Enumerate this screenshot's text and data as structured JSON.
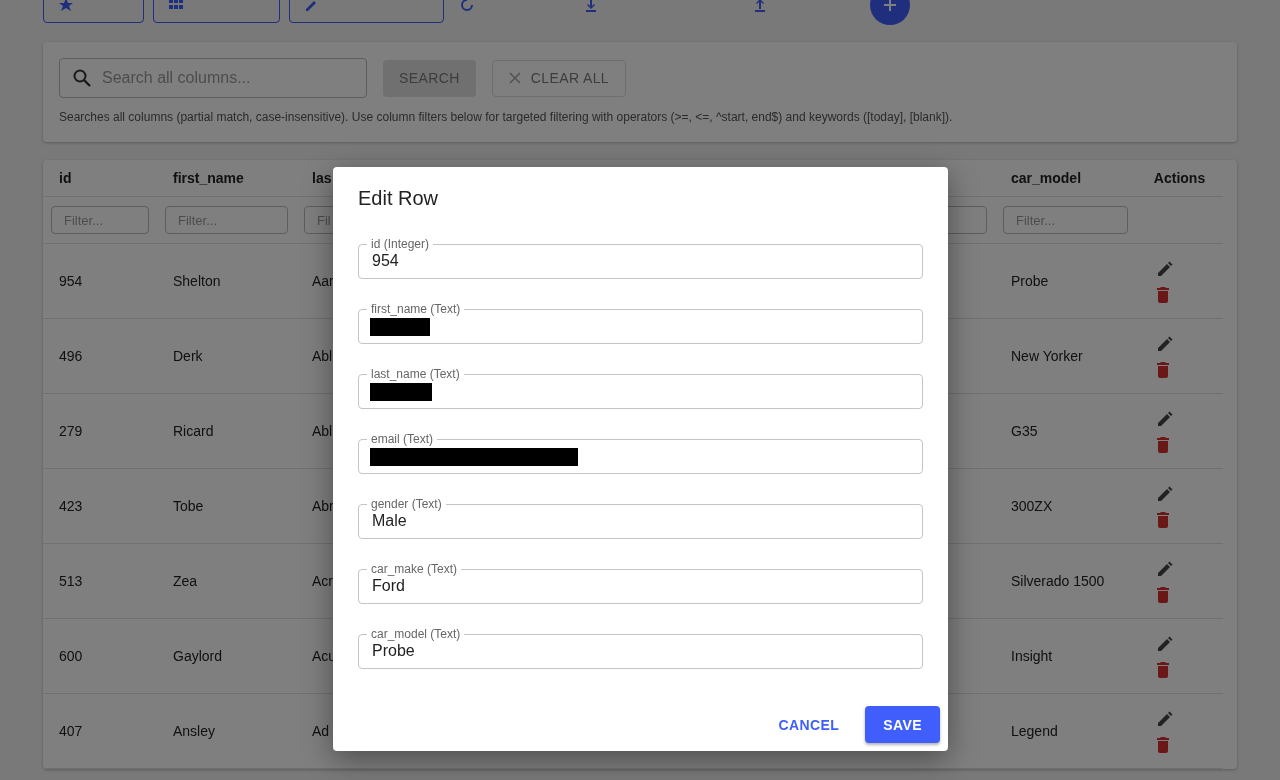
{
  "toolbar": {
    "buttons": [
      {
        "kind": "outlined"
      },
      {
        "kind": "outlined"
      },
      {
        "kind": "outlined"
      },
      {
        "kind": "text"
      },
      {
        "kind": "text"
      },
      {
        "kind": "text"
      },
      {
        "kind": "fab"
      }
    ]
  },
  "search": {
    "placeholder": "Search all columns...",
    "buttons": [
      {
        "label": "SEARCH",
        "kind": "contained",
        "disabled": true
      },
      {
        "label": "CLEAR ALL",
        "kind": "outlined",
        "disabled": true
      }
    ],
    "hint": "Searches all columns (partial match, case-insensitive). Use column filters below for targeted filtering with operators (>=, <=, ^start, end$) and keywords ([today], [blank])."
  },
  "table": {
    "columns": [
      {
        "header": "id",
        "placeholder": "Filter..."
      },
      {
        "header": "first_name",
        "placeholder": "Filter..."
      },
      {
        "header": "las",
        "placeholder": "Fil"
      },
      {},
      {
        "header": "car_model",
        "placeholder": "Filter..."
      },
      {
        "header": "Actions"
      }
    ],
    "rows": [
      {
        "id": "954",
        "first_name": "Shelton",
        "column_3": "Aar",
        "car_model": "Probe"
      },
      {
        "id": "496",
        "first_name": "Derk",
        "column_3": "Abl",
        "car_model": "New Yorker"
      },
      {
        "id": "279",
        "first_name": "Ricard",
        "column_3": "Abl",
        "car_model": "G35"
      },
      {
        "id": "423",
        "first_name": "Tobe",
        "column_3": "Abr",
        "car_model": "300ZX"
      },
      {
        "id": "513",
        "first_name": "Zea",
        "column_3": "Acr",
        "car_model": "Silverado 1500"
      },
      {
        "id": "600",
        "first_name": "Gaylord",
        "column_3": "Acu",
        "car_model": "Insight"
      },
      {
        "id": "407",
        "first_name": "Ansley",
        "column_3": "Ad",
        "car_model": "Legend"
      }
    ]
  },
  "dialog": {
    "title": "Edit Row",
    "fields": [
      {
        "label": "id (Integer)",
        "value": "954",
        "redacted": false
      },
      {
        "label": "first_name (Text)",
        "redacted": true
      },
      {
        "label": "last_name (Text)",
        "redacted": true
      },
      {
        "label": "email (Text)",
        "redacted": true
      },
      {
        "label": "gender (Text)",
        "value": "Male",
        "redacted": false
      },
      {
        "label": "car_make (Text)",
        "value": "Ford",
        "redacted": false
      },
      {
        "label": "car_model (Text)",
        "value": "Probe",
        "redacted": false
      }
    ],
    "buttons": [
      {
        "label": "CANCEL",
        "kind": "text"
      },
      {
        "label": "SAVE",
        "kind": "contained"
      }
    ]
  }
}
